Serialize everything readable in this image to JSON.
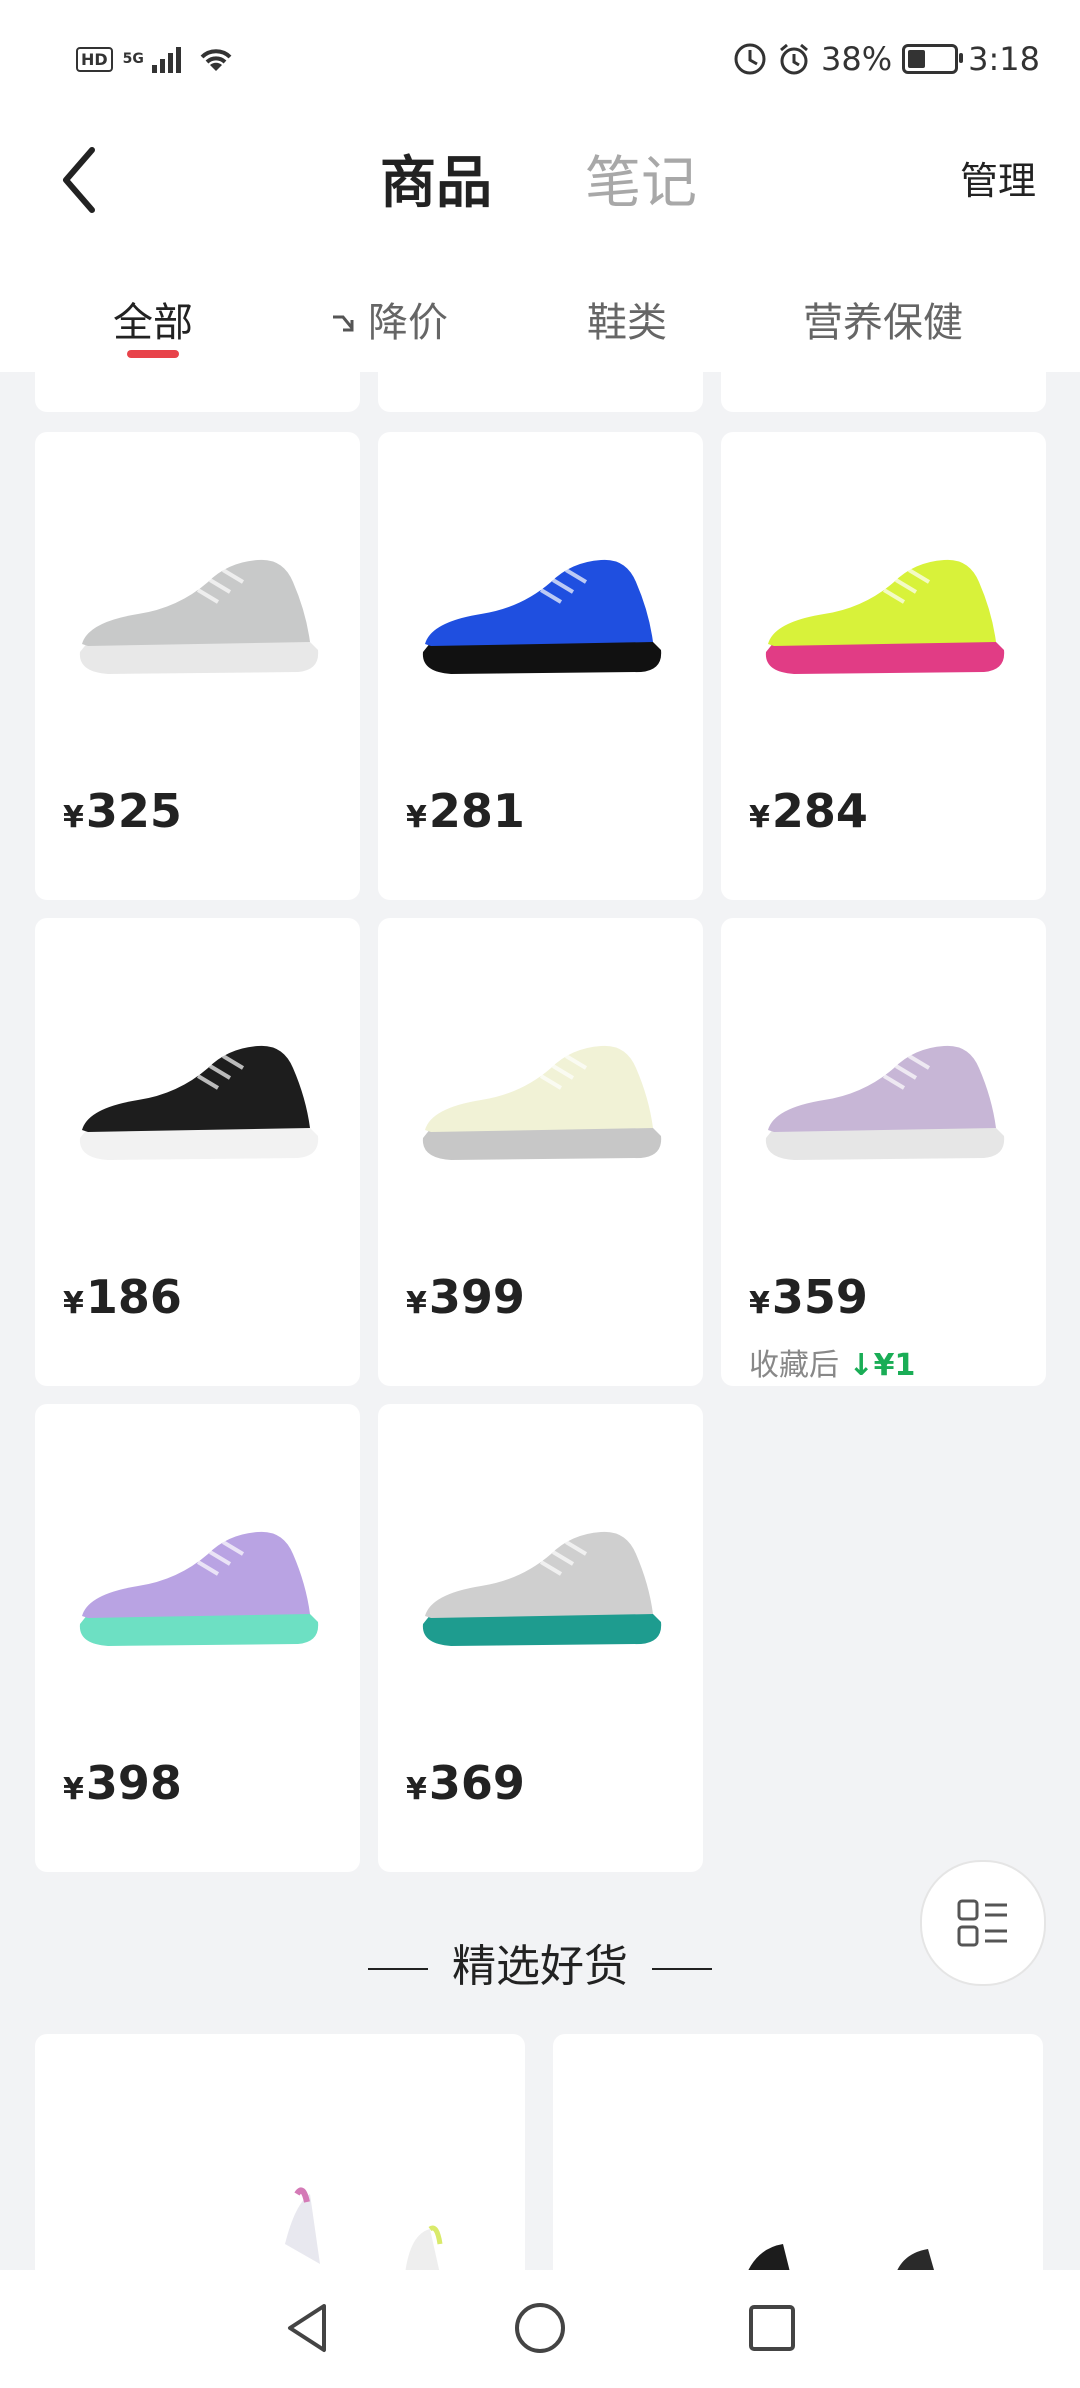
{
  "status": {
    "hd": "HD",
    "network": "5G",
    "battery": "38%",
    "battery_level": 0.38,
    "time": "3:18"
  },
  "header": {
    "tab_active": "商品",
    "tab_inactive": "笔记",
    "manage": "管理"
  },
  "filters": [
    "全部",
    "降价",
    "鞋类",
    "营养保健"
  ],
  "products": [
    {
      "price": "325",
      "colors": [
        "#c8c9c9",
        "#e8e8e8"
      ]
    },
    {
      "price": "281",
      "colors": [
        "#1f4fe0",
        "#111"
      ]
    },
    {
      "price": "284",
      "colors": [
        "#d8f23a",
        "#e13c85"
      ]
    },
    {
      "price": "186",
      "colors": [
        "#1d1d1d",
        "#f2f2f2"
      ]
    },
    {
      "price": "399",
      "colors": [
        "#f1f2d6",
        "#c7c7c7"
      ]
    },
    {
      "price": "359",
      "colors": [
        "#c7b6d6",
        "#e6e6e6"
      ],
      "note_prefix": "收藏后",
      "note_drop": "↓¥1"
    },
    {
      "price": "398",
      "colors": [
        "#b9a3e3",
        "#6de0c3"
      ]
    },
    {
      "price": "369",
      "colors": [
        "#cfcfcf",
        "#1e9c8f"
      ]
    }
  ],
  "yen": "¥",
  "section_title": "精选好货",
  "icons": [
    "back-icon",
    "signal-icon",
    "wifi-icon",
    "alarm-icon",
    "battery-icon",
    "list-view-icon",
    "nav-back-icon",
    "nav-home-icon",
    "nav-recent-icon"
  ]
}
